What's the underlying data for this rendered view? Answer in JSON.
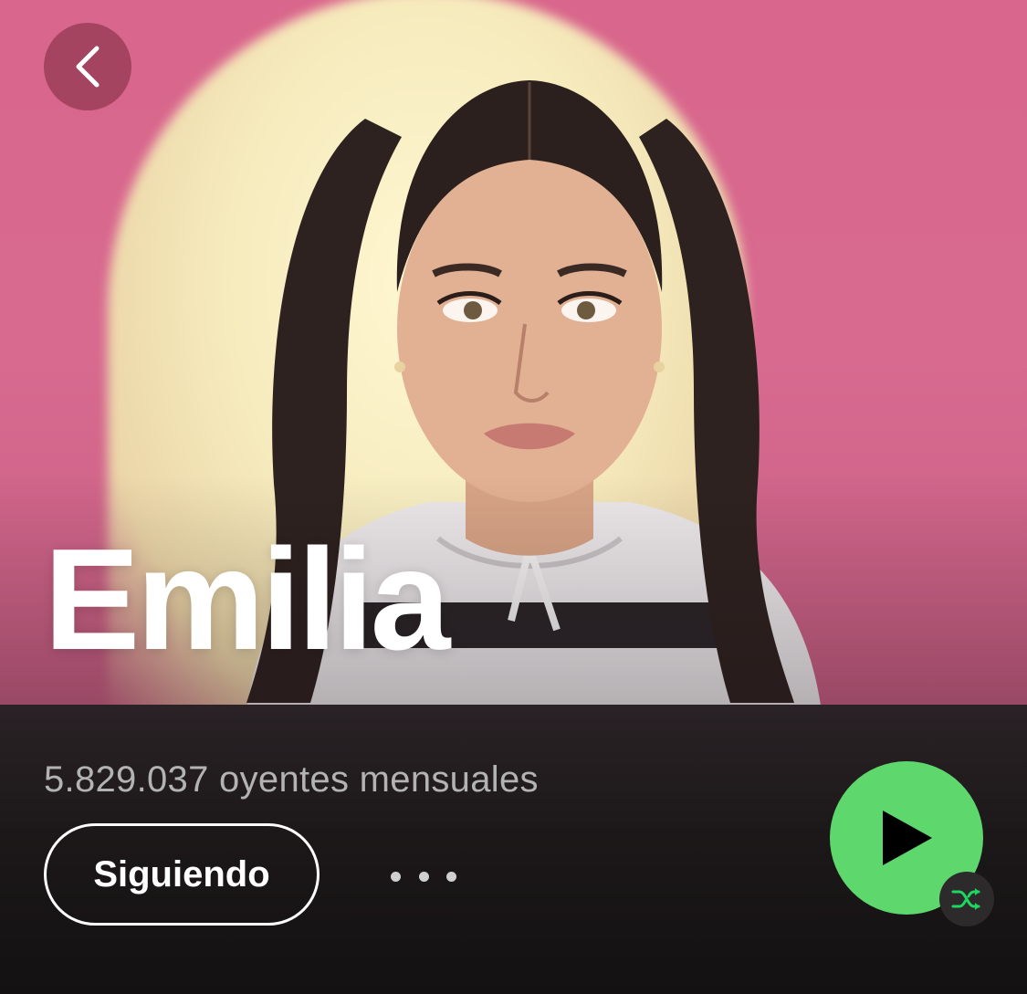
{
  "artist": {
    "name": "Emilia",
    "monthly_listeners": "5.829.037 oyentes mensuales"
  },
  "actions": {
    "follow_label": "Siguiendo",
    "more_icon": "more-horizontal-icon",
    "play_icon": "play-icon",
    "shuffle_icon": "shuffle-icon",
    "back_icon": "chevron-left-icon"
  },
  "colors": {
    "hero_background": "#d9668c",
    "spotlight": "#f6ebbd",
    "accent_green": "#5ed86c",
    "shuffle_green": "#1ed760",
    "page_background": "#151314",
    "secondary_text": "#b3b3b3"
  }
}
